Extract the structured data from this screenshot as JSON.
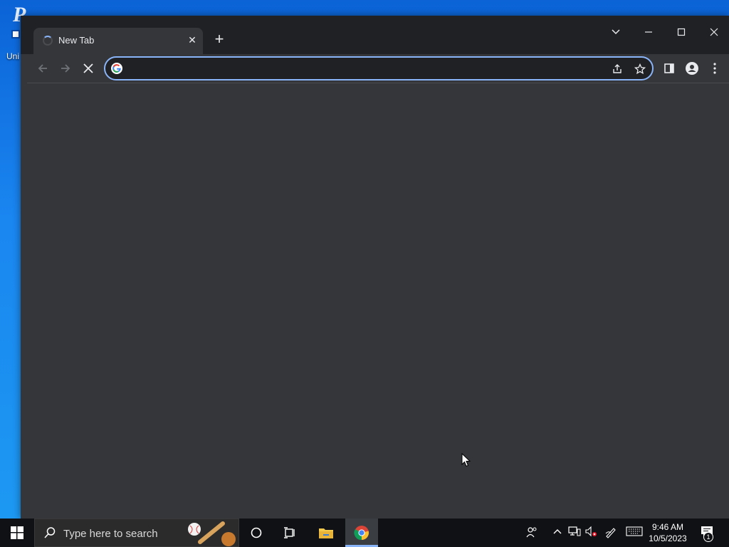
{
  "desktop": {
    "icon_label": "Uni"
  },
  "browser": {
    "tab": {
      "title": "New Tab",
      "close_label": "✕"
    },
    "new_tab_label": "+",
    "window_controls": {
      "tab_search": "⌄",
      "minimize": "—",
      "maximize": "☐",
      "close": "✕"
    },
    "toolbar": {
      "back": "←",
      "forward": "→",
      "stop": "✕",
      "omnibox_value": "",
      "omnibox_placeholder": "",
      "share": "⇪",
      "bookmark": "☆",
      "side_panel": "▮",
      "profile": "●",
      "menu": "⋮"
    },
    "accent_color": "#8ab4f8"
  },
  "taskbar": {
    "search_placeholder": "Type here to search",
    "clock": {
      "time": "9:46 AM",
      "date": "10/5/2023"
    },
    "notification_count": "1"
  }
}
